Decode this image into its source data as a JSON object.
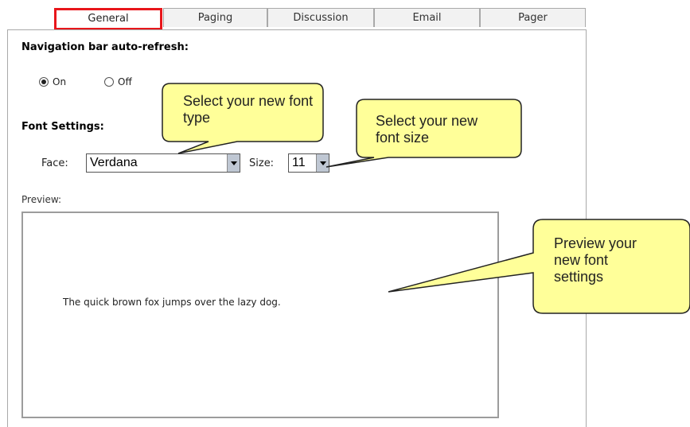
{
  "tabs": [
    "General",
    "Paging",
    "Discussion",
    "Email",
    "Pager"
  ],
  "nav_refresh": {
    "title": "Navigation bar auto-refresh:",
    "on_label": "On",
    "off_label": "Off",
    "selected": "On"
  },
  "font_settings": {
    "title": "Font Settings:",
    "face_label": "Face:",
    "face_value": "Verdana",
    "size_label": "Size:",
    "size_value": "11"
  },
  "preview": {
    "label": "Preview:",
    "sample_text": "The quick brown fox jumps over the lazy dog."
  },
  "callouts": {
    "font_type": "Select your new font type",
    "font_size": "Select your new font size",
    "preview": "Preview your new font settings"
  },
  "colors": {
    "callout_fill": "#ffff99",
    "active_tab_border": "#e8161b"
  }
}
